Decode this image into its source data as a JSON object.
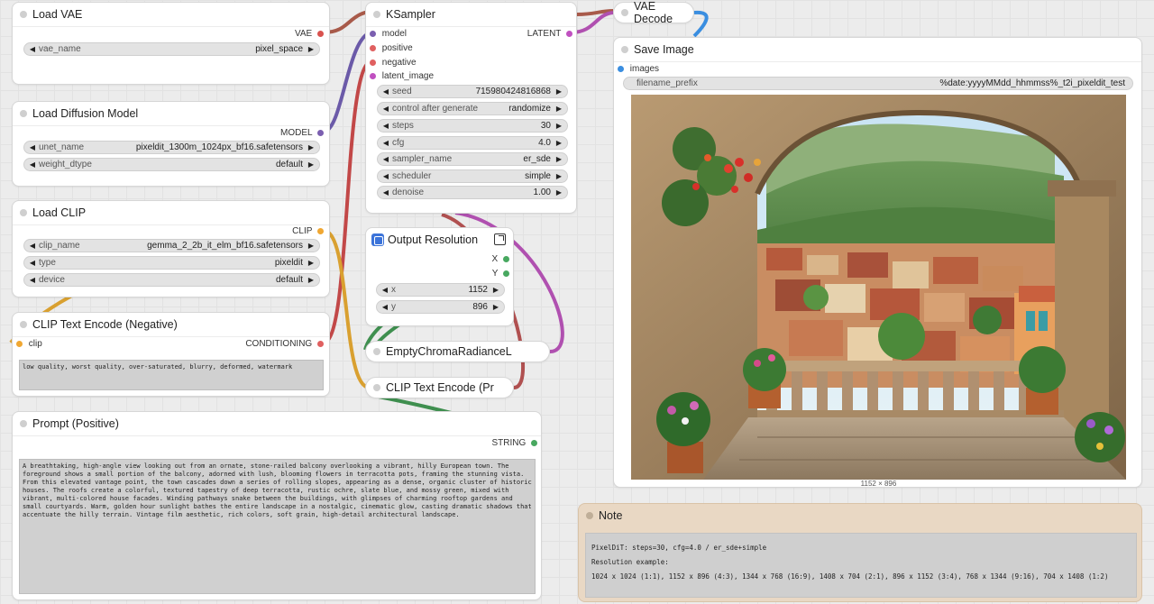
{
  "colors": {
    "model_socket": "#7b5fb0",
    "vae_socket": "#d9534f",
    "clip_socket": "#f0a732",
    "conditioning_socket": "#e06060",
    "latent_socket": "#c050c0",
    "image_socket": "#3a8ee0",
    "int_socket": "#48a860",
    "string_socket": "#48a860"
  },
  "load_vae": {
    "title": "Load VAE",
    "output_label": "VAE",
    "vae_name_label": "vae_name",
    "vae_name_value": "pixel_space"
  },
  "load_diffusion": {
    "title": "Load Diffusion Model",
    "output_label": "MODEL",
    "unet_name_label": "unet_name",
    "unet_name_value": "pixeldit_1300m_1024px_bf16.safetensors",
    "weight_dtype_label": "weight_dtype",
    "weight_dtype_value": "default"
  },
  "load_clip": {
    "title": "Load CLIP",
    "output_label": "CLIP",
    "clip_name_label": "clip_name",
    "clip_name_value": "gemma_2_2b_it_elm_bf16.safetensors",
    "type_label": "type",
    "type_value": "pixeldit",
    "device_label": "device",
    "device_value": "default"
  },
  "clip_neg": {
    "title": "CLIP Text Encode (Negative)",
    "input_label": "clip",
    "output_label": "CONDITIONING",
    "text": "low quality, worst quality, over-saturated, blurry, deformed, watermark"
  },
  "prompt_pos": {
    "title": "Prompt (Positive)",
    "output_label": "STRING",
    "text": "A breathtaking, high-angle view looking out from an ornate, stone-railed balcony overlooking a vibrant, hilly European town. The foreground shows a small portion of the balcony, adorned with lush, blooming flowers in terracotta pots, framing the stunning vista. From this elevated vantage point, the town cascades down a series of rolling slopes, appearing as a dense, organic cluster of historic houses. The roofs create a colorful, textured tapestry of deep terracotta, rustic ochre, slate blue, and mossy green, mixed with vibrant, multi-colored house facades. Winding pathways snake between the buildings, with glimpses of charming rooftop gardens and small courtyards. Warm, golden hour sunlight bathes the entire landscape in a nostalgic, cinematic glow, casting dramatic shadows that accentuate the hilly terrain. Vintage film aesthetic, rich colors, soft grain, high-detail architectural landscape."
  },
  "ksampler": {
    "title": "KSampler",
    "inputs": [
      "model",
      "positive",
      "negative",
      "latent_image"
    ],
    "output_label": "LATENT",
    "widgets": [
      {
        "label": "seed",
        "value": "715980424816868"
      },
      {
        "label": "control after generate",
        "value": "randomize"
      },
      {
        "label": "steps",
        "value": "30"
      },
      {
        "label": "cfg",
        "value": "4.0"
      },
      {
        "label": "sampler_name",
        "value": "er_sde"
      },
      {
        "label": "scheduler",
        "value": "simple"
      },
      {
        "label": "denoise",
        "value": "1.00"
      }
    ]
  },
  "output_resolution": {
    "title": "Output Resolution",
    "outputs": [
      "X",
      "Y"
    ],
    "x_label": "x",
    "x_value": "1152",
    "y_label": "y",
    "y_value": "896"
  },
  "empty_chroma": {
    "title": "EmptyChromaRadianceL"
  },
  "clip_pos": {
    "title": "CLIP Text Encode (Pr"
  },
  "vae_decode": {
    "title": "VAE Decode"
  },
  "save_image": {
    "title": "Save Image",
    "input_label": "images",
    "prefix_label": "filename_prefix",
    "prefix_value": "%date:yyyyMMdd_hhmmss%_t2i_pixeldit_test",
    "image_caption": "1152 × 896"
  },
  "note": {
    "title": "Note",
    "lines": [
      "PixelDiT: steps=30, cfg=4.0 / er_sde+simple",
      "Resolution example:",
      "1024 x 1024 (1:1), 1152 x 896 (4:3), 1344 x 768 (16:9), 1408 x 704 (2:1), 896 x 1152 (3:4), 768 x 1344 (9:16), 704 x 1408 (1:2)"
    ]
  }
}
